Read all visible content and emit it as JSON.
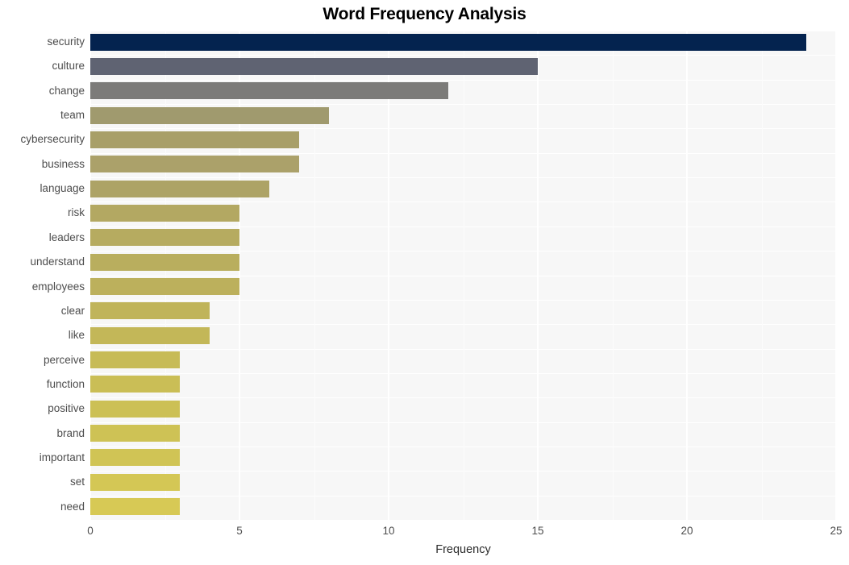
{
  "chart_data": {
    "type": "bar",
    "orientation": "horizontal",
    "title": "Word Frequency Analysis",
    "xlabel": "Frequency",
    "ylabel": "",
    "xlim": [
      0,
      25
    ],
    "xticks": [
      0,
      5,
      10,
      15,
      20,
      25
    ],
    "xtick_labels": [
      "0",
      "5",
      "10",
      "15",
      "20",
      "25"
    ],
    "grid": true,
    "legend": "none",
    "categories": [
      "security",
      "culture",
      "change",
      "team",
      "cybersecurity",
      "business",
      "language",
      "risk",
      "leaders",
      "understand",
      "employees",
      "clear",
      "like",
      "perceive",
      "function",
      "positive",
      "brand",
      "important",
      "set",
      "need"
    ],
    "values": [
      24,
      15,
      12,
      8,
      7,
      7,
      6,
      5,
      5,
      5,
      5,
      4,
      4,
      3,
      3,
      3,
      3,
      3,
      3,
      3
    ],
    "bar_colors": [
      "#04234f",
      "#5f6372",
      "#7c7b79",
      "#a09a6e",
      "#a89f68",
      "#ab a16a",
      "#ada366",
      "#b3a862",
      "#b6ab60",
      "#b9ae5e",
      "#bcb05c",
      "#c0b45a",
      "#c3b758",
      "#c7bb57",
      "#cabe56",
      "#ccc055",
      "#cec255",
      "#d0c455",
      "#d4c755",
      "#d7c955"
    ],
    "panel_background": "#f7f7f7",
    "gridline_color": "#ffffff",
    "page_background": "#ffffff"
  }
}
